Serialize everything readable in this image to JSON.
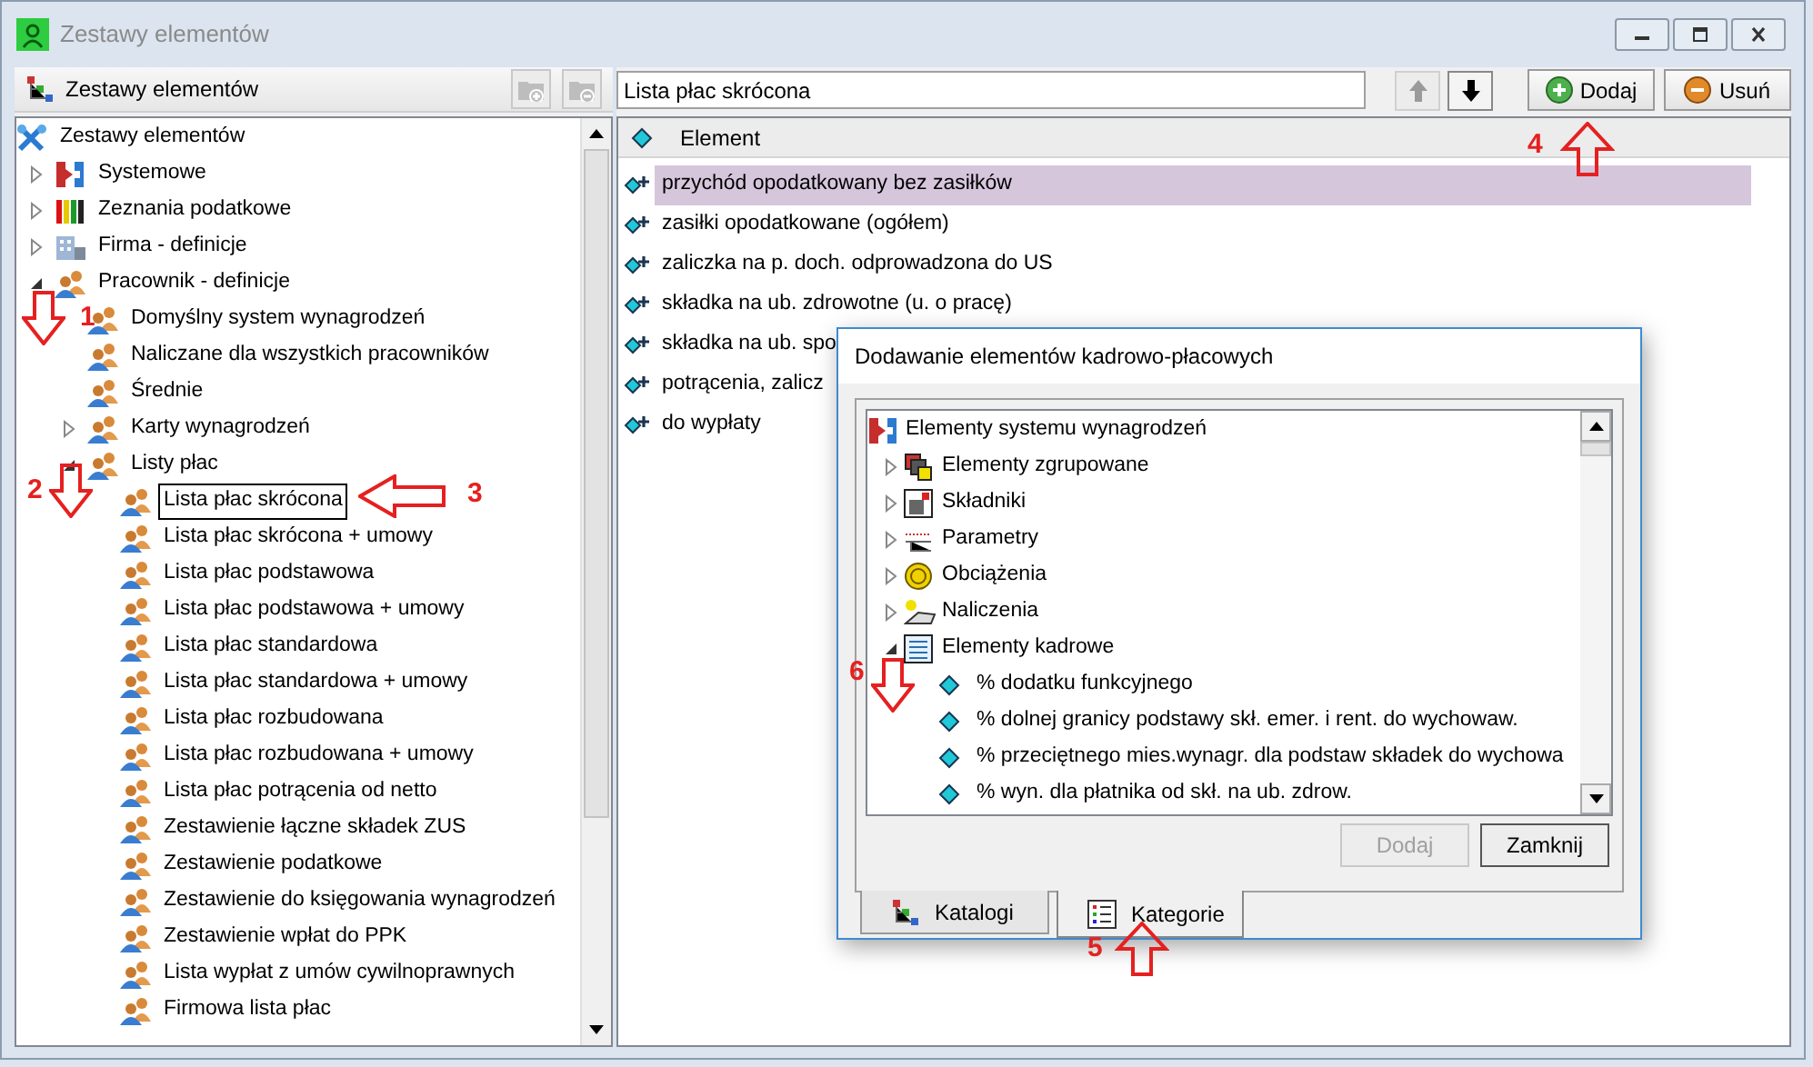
{
  "window": {
    "title": "Zestawy elementów"
  },
  "left_panel": {
    "title": "Zestawy elementów",
    "toolbar_buttons": [
      {
        "kind": "folder-add",
        "disabled": true
      },
      {
        "kind": "folder-remove",
        "disabled": true
      }
    ],
    "tree": [
      {
        "label": "Zestawy elementów",
        "kind": "tools",
        "selected": false,
        "children": [
          {
            "label": "Systemowe",
            "kind": "system",
            "selected": false,
            "expanded": false
          },
          {
            "label": "Zeznania podatkowe",
            "kind": "tax",
            "selected": false,
            "expanded": false
          },
          {
            "label": "Firma - definicje",
            "kind": "company",
            "selected": false,
            "expanded": false
          },
          {
            "label": "Pracownik - definicje",
            "kind": "people",
            "selected": false,
            "expanded": true,
            "children": [
              {
                "label": "Domyślny system wynagrodzeń",
                "kind": "people",
                "selected": false
              },
              {
                "label": "Naliczane dla wszystkich pracowników",
                "kind": "people",
                "selected": false
              },
              {
                "label": "Średnie",
                "kind": "people",
                "selected": false
              },
              {
                "label": "Karty wynagrodzeń",
                "kind": "people",
                "selected": false,
                "expanded": false
              },
              {
                "label": "Listy płac",
                "kind": "people",
                "selected": false,
                "expanded": true,
                "children": [
                  {
                    "label": "Lista płac skrócona",
                    "kind": "people",
                    "selected": true
                  },
                  {
                    "label": "Lista płac skrócona + umowy",
                    "kind": "people",
                    "selected": false
                  },
                  {
                    "label": "Lista płac podstawowa",
                    "kind": "people",
                    "selected": false
                  },
                  {
                    "label": "Lista płac podstawowa + umowy",
                    "kind": "people",
                    "selected": false
                  },
                  {
                    "label": "Lista płac standardowa",
                    "kind": "people",
                    "selected": false
                  },
                  {
                    "label": "Lista płac standardowa + umowy",
                    "kind": "people",
                    "selected": false
                  },
                  {
                    "label": "Lista płac rozbudowana",
                    "kind": "people",
                    "selected": false
                  },
                  {
                    "label": "Lista płac rozbudowana + umowy",
                    "kind": "people",
                    "selected": false
                  },
                  {
                    "label": "Lista płac potrącenia od netto",
                    "kind": "people",
                    "selected": false
                  },
                  {
                    "label": "Zestawienie łączne składek ZUS",
                    "kind": "people",
                    "selected": false
                  },
                  {
                    "label": "Zestawienie podatkowe",
                    "kind": "people",
                    "selected": false
                  },
                  {
                    "label": "Zestawienie do księgowania wynagrodzeń",
                    "kind": "people",
                    "selected": false
                  },
                  {
                    "label": "Zestawienie wpłat do PPK",
                    "kind": "people",
                    "selected": false
                  },
                  {
                    "label": "Lista wypłat z umów cywilnoprawnych",
                    "kind": "people",
                    "selected": false
                  },
                  {
                    "label": "Firmowa lista płac",
                    "kind": "people",
                    "selected": false
                  }
                ]
              }
            ]
          }
        ]
      }
    ]
  },
  "right_panel": {
    "name_field": {
      "value": "Lista płac skrócona"
    },
    "move_buttons": [
      {
        "kind": "up",
        "disabled": true
      },
      {
        "kind": "down",
        "disabled": false
      }
    ],
    "buttons": [
      {
        "label": "Dodaj",
        "kind": "add"
      },
      {
        "label": "Usuń",
        "kind": "remove"
      }
    ],
    "columns": [
      "Element"
    ],
    "rows": [
      {
        "text": "przychód opodatkowany bez zasiłków",
        "selected": true
      },
      {
        "text": "zasiłki opodatkowane (ogółem)",
        "selected": false
      },
      {
        "text": "zaliczka na p. doch. odprowadzona do US",
        "selected": false
      },
      {
        "text": "składka na ub. zdrowotne (u. o pracę)",
        "selected": false
      },
      {
        "text": "składka na ub. spo",
        "selected": false
      },
      {
        "text": "potrącenia, zalicz",
        "selected": false
      },
      {
        "text": "do wypłaty",
        "selected": false
      }
    ]
  },
  "dialog": {
    "title": "Dodawanie elementów kadrowo-płacowych",
    "tree": [
      {
        "label": "Elementy systemu wynagrodzeń",
        "kind": "system",
        "children": [
          {
            "label": "Elementy zgrupowane",
            "kind": "group",
            "expanded": false
          },
          {
            "label": "Składniki",
            "kind": "components",
            "expanded": false
          },
          {
            "label": "Parametry",
            "kind": "params",
            "expanded": false
          },
          {
            "label": "Obciążenia",
            "kind": "loads",
            "expanded": false
          },
          {
            "label": "Naliczenia",
            "kind": "calc",
            "expanded": false
          },
          {
            "label": "Elementy kadrowe",
            "kind": "hr",
            "expanded": true,
            "children": [
              {
                "label": "% dodatku funkcyjnego",
                "kind": "element"
              },
              {
                "label": "% dolnej granicy podstawy skł. emer. i rent. do wychowaw.",
                "kind": "element"
              },
              {
                "label": "% przeciętnego mies.wynagr. dla podstaw składek do wychowa",
                "kind": "element"
              },
              {
                "label": "% wyn. dla płatnika od skł. na ub. zdrow.",
                "kind": "element"
              }
            ]
          }
        ]
      }
    ],
    "buttons": [
      {
        "label": "Dodaj",
        "disabled": true
      },
      {
        "label": "Zamknij",
        "disabled": false
      }
    ],
    "tabs": [
      {
        "label": "Katalogi",
        "kind": "catalog",
        "selected": false
      },
      {
        "label": "Kategorie",
        "kind": "category",
        "selected": true
      }
    ]
  },
  "annotations": [
    {
      "label": "1",
      "kind": "down"
    },
    {
      "label": "2",
      "kind": "down"
    },
    {
      "label": "3",
      "kind": "left"
    },
    {
      "label": "4",
      "kind": "up"
    },
    {
      "label": "5",
      "kind": "up"
    },
    {
      "label": "6",
      "kind": "down"
    }
  ]
}
